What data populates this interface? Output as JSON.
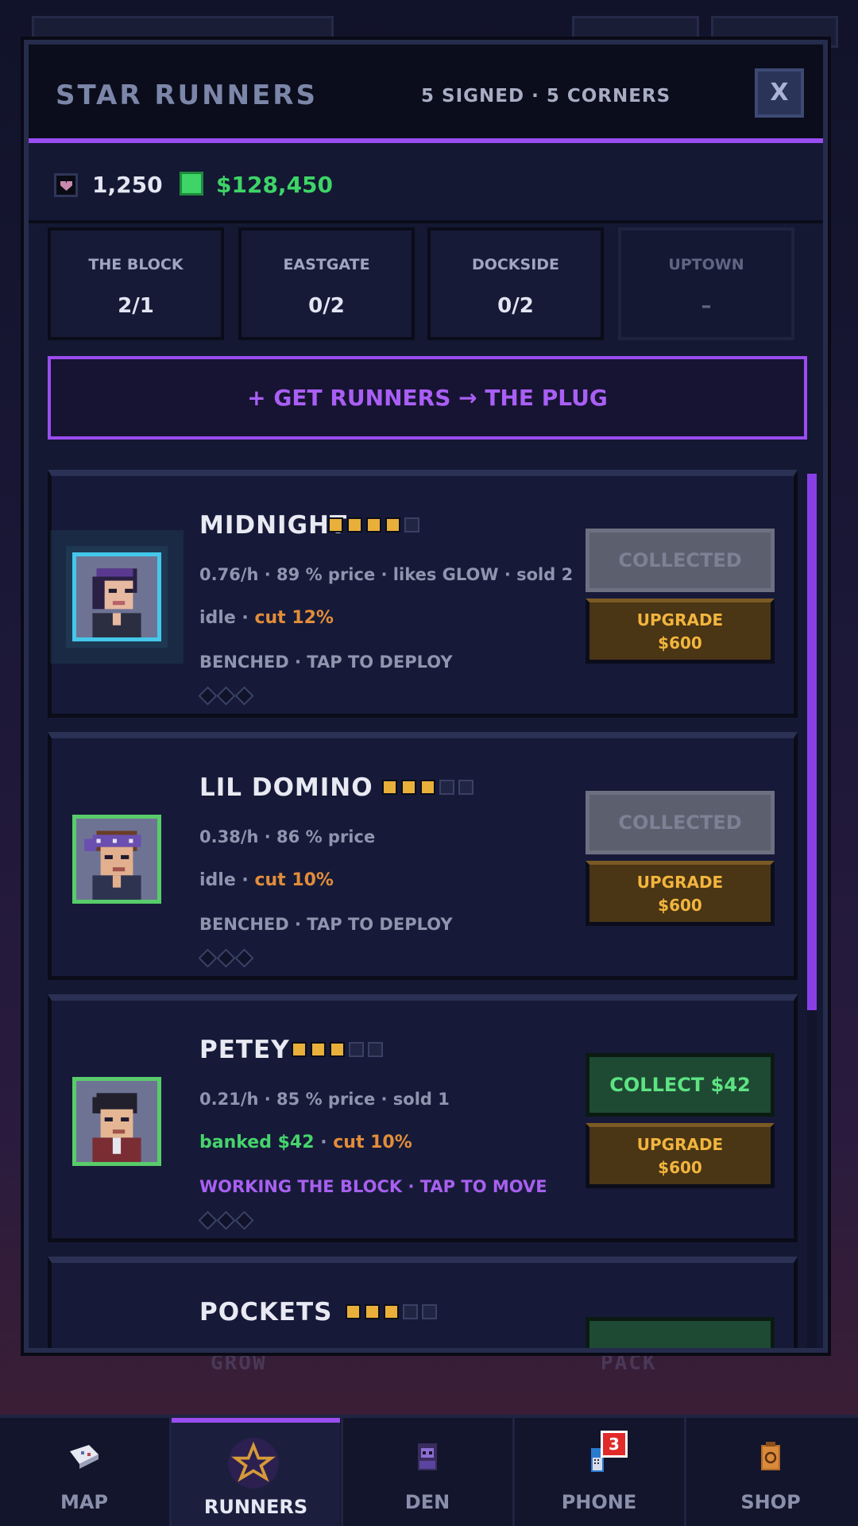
{
  "modal": {
    "title": "STAR RUNNERS",
    "subtitle": "5 SIGNED · 5 CORNERS",
    "close_label": "X"
  },
  "currency": {
    "hearts": "1,250",
    "cash": "$128,450"
  },
  "territories": [
    {
      "name": "THE BLOCK",
      "value": "2/1",
      "locked": false
    },
    {
      "name": "EASTGATE",
      "value": "0/2",
      "locked": false
    },
    {
      "name": "DOCKSIDE",
      "value": "0/2",
      "locked": false
    },
    {
      "name": "UPTOWN",
      "value": "–",
      "locked": true
    }
  ],
  "get_runners_label": "+ GET RUNNERS → THE PLUG",
  "runners": [
    {
      "name": "MIDNIGHT",
      "stars": 4,
      "stats": "0.76/h · 89 % price · likes GLOW · sold 2",
      "state_prefix": "idle · ",
      "cut": "cut 12%",
      "status": "BENCHED · TAP TO DEPLOY",
      "collect_label": "COLLECTED",
      "collect_enabled": false,
      "upgrade_label": "UPGRADE",
      "upgrade_price": "$600"
    },
    {
      "name": "LIL DOMINO",
      "stars": 3,
      "stats": "0.38/h · 86 % price",
      "state_prefix": "idle · ",
      "cut": "cut 10%",
      "status": "BENCHED · TAP TO DEPLOY",
      "collect_label": "COLLECTED",
      "collect_enabled": false,
      "upgrade_label": "UPGRADE",
      "upgrade_price": "$600"
    },
    {
      "name": "PETEY",
      "stars": 3,
      "stats": "0.21/h · 85 % price · sold 1",
      "banked": "banked $42",
      "cut": "cut 10%",
      "status": "WORKING THE BLOCK · TAP TO MOVE",
      "collect_label": "COLLECT $42",
      "collect_enabled": true,
      "upgrade_label": "UPGRADE",
      "upgrade_price": "$600"
    },
    {
      "name": "POCKETS",
      "stars": 3
    }
  ],
  "nav": [
    {
      "label": "MAP",
      "icon": "map-icon"
    },
    {
      "label": "RUNNERS",
      "icon": "runner-icon",
      "active": true
    },
    {
      "label": "DEN",
      "icon": "den-icon"
    },
    {
      "label": "PHONE",
      "icon": "phone-icon",
      "badge": "3"
    },
    {
      "label": "SHOP",
      "icon": "shop-icon"
    }
  ],
  "background": {
    "labels": [
      "GROW",
      "PACK"
    ]
  },
  "colors": {
    "accent": "#9a4df0",
    "cash": "#3ed467",
    "gold": "#e8b03a",
    "cut": "#e38d3a"
  }
}
